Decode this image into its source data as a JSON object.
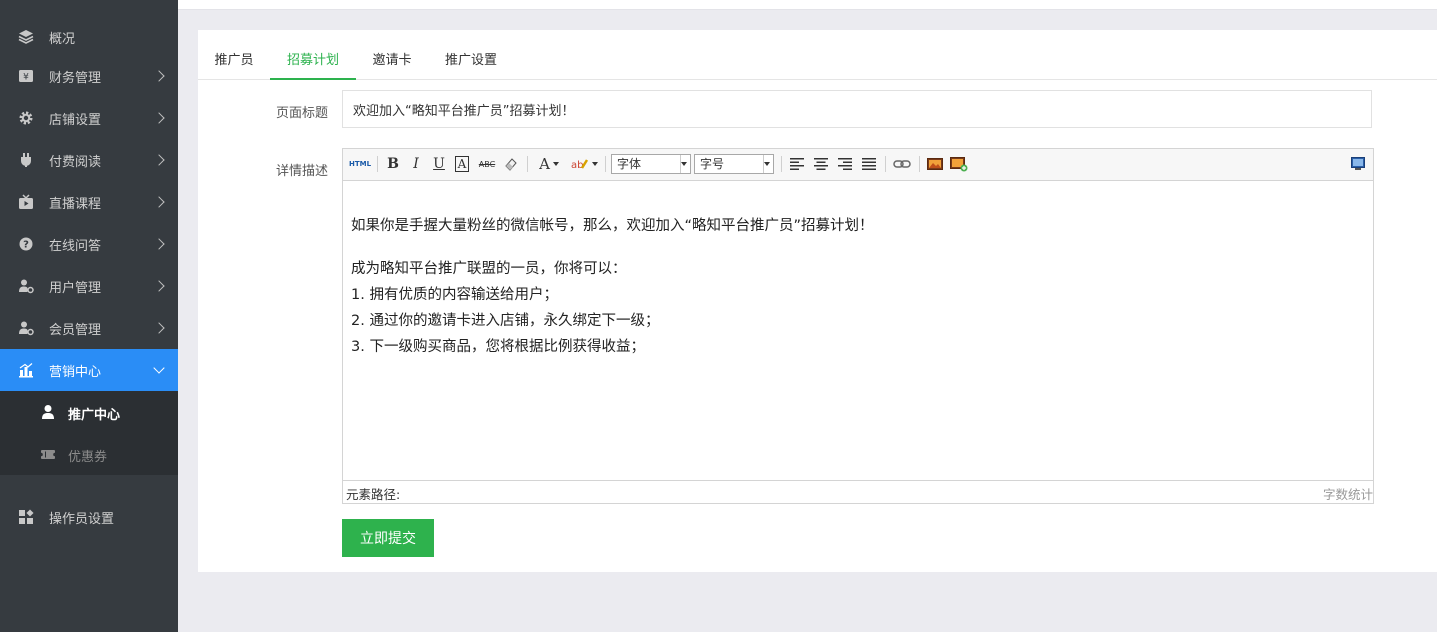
{
  "sidebar": {
    "items": [
      {
        "label": "概况"
      },
      {
        "label": "财务管理"
      },
      {
        "label": "店铺设置"
      },
      {
        "label": "付费阅读"
      },
      {
        "label": "直播课程"
      },
      {
        "label": "在线问答"
      },
      {
        "label": "用户管理"
      },
      {
        "label": "会员管理"
      },
      {
        "label": "营销中心"
      }
    ],
    "sub_items": [
      {
        "label": "推广中心"
      },
      {
        "label": "优惠券"
      }
    ],
    "operator": {
      "label": "操作员设置"
    }
  },
  "tabs": [
    {
      "label": "推广员"
    },
    {
      "label": "招募计划"
    },
    {
      "label": "邀请卡"
    },
    {
      "label": "推广设置"
    }
  ],
  "form": {
    "title_label": "页面标题",
    "title_value": "欢迎加入“略知平台推广员”招募计划！",
    "desc_label": "详情描述"
  },
  "editor": {
    "toolbar": {
      "html": "HTML",
      "bold": "B",
      "italic": "I",
      "underline": "U",
      "font_border": "A",
      "strike": "ABC",
      "font_color": "A",
      "font_family": "字体",
      "font_size": "字号"
    },
    "paragraphs": [
      "如果你是手握大量粉丝的微信帐号，那么，欢迎加入“略知平台推广员”招募计划！",
      "成为略知平台推广联盟的一员，你将可以：",
      "1. 拥有优质的内容输送给用户；",
      "2. 通过你的邀请卡进入店铺，永久绑定下一级；",
      "3. 下一级购买商品，您将根据比例获得收益；"
    ],
    "element_path": "元素路径:",
    "word_count": "字数统计"
  },
  "submit_label": "立即提交",
  "colors": {
    "sidebar_bg": "#363b40",
    "active_blue": "#2a8df6",
    "accent_green": "#2eb24d"
  }
}
